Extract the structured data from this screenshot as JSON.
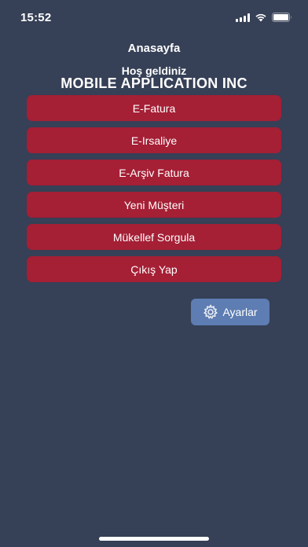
{
  "status_bar": {
    "time": "15:52"
  },
  "header": {
    "title": "Anasayfa",
    "welcome": "Hoş geldiniz",
    "company": "MOBILE APPLICATION INC"
  },
  "menu": {
    "items": [
      {
        "label": "E-Fatura"
      },
      {
        "label": "E-Irsaliye"
      },
      {
        "label": "E-Arşiv Fatura"
      },
      {
        "label": "Yeni Müşteri"
      },
      {
        "label": "Mükellef Sorgula"
      },
      {
        "label": "Çıkış Yap"
      }
    ]
  },
  "settings": {
    "label": "Ayarlar",
    "icon": "gear-icon"
  },
  "colors": {
    "background": "#364056",
    "menu_button": "#a51f35",
    "settings_button": "#5d7db3"
  }
}
